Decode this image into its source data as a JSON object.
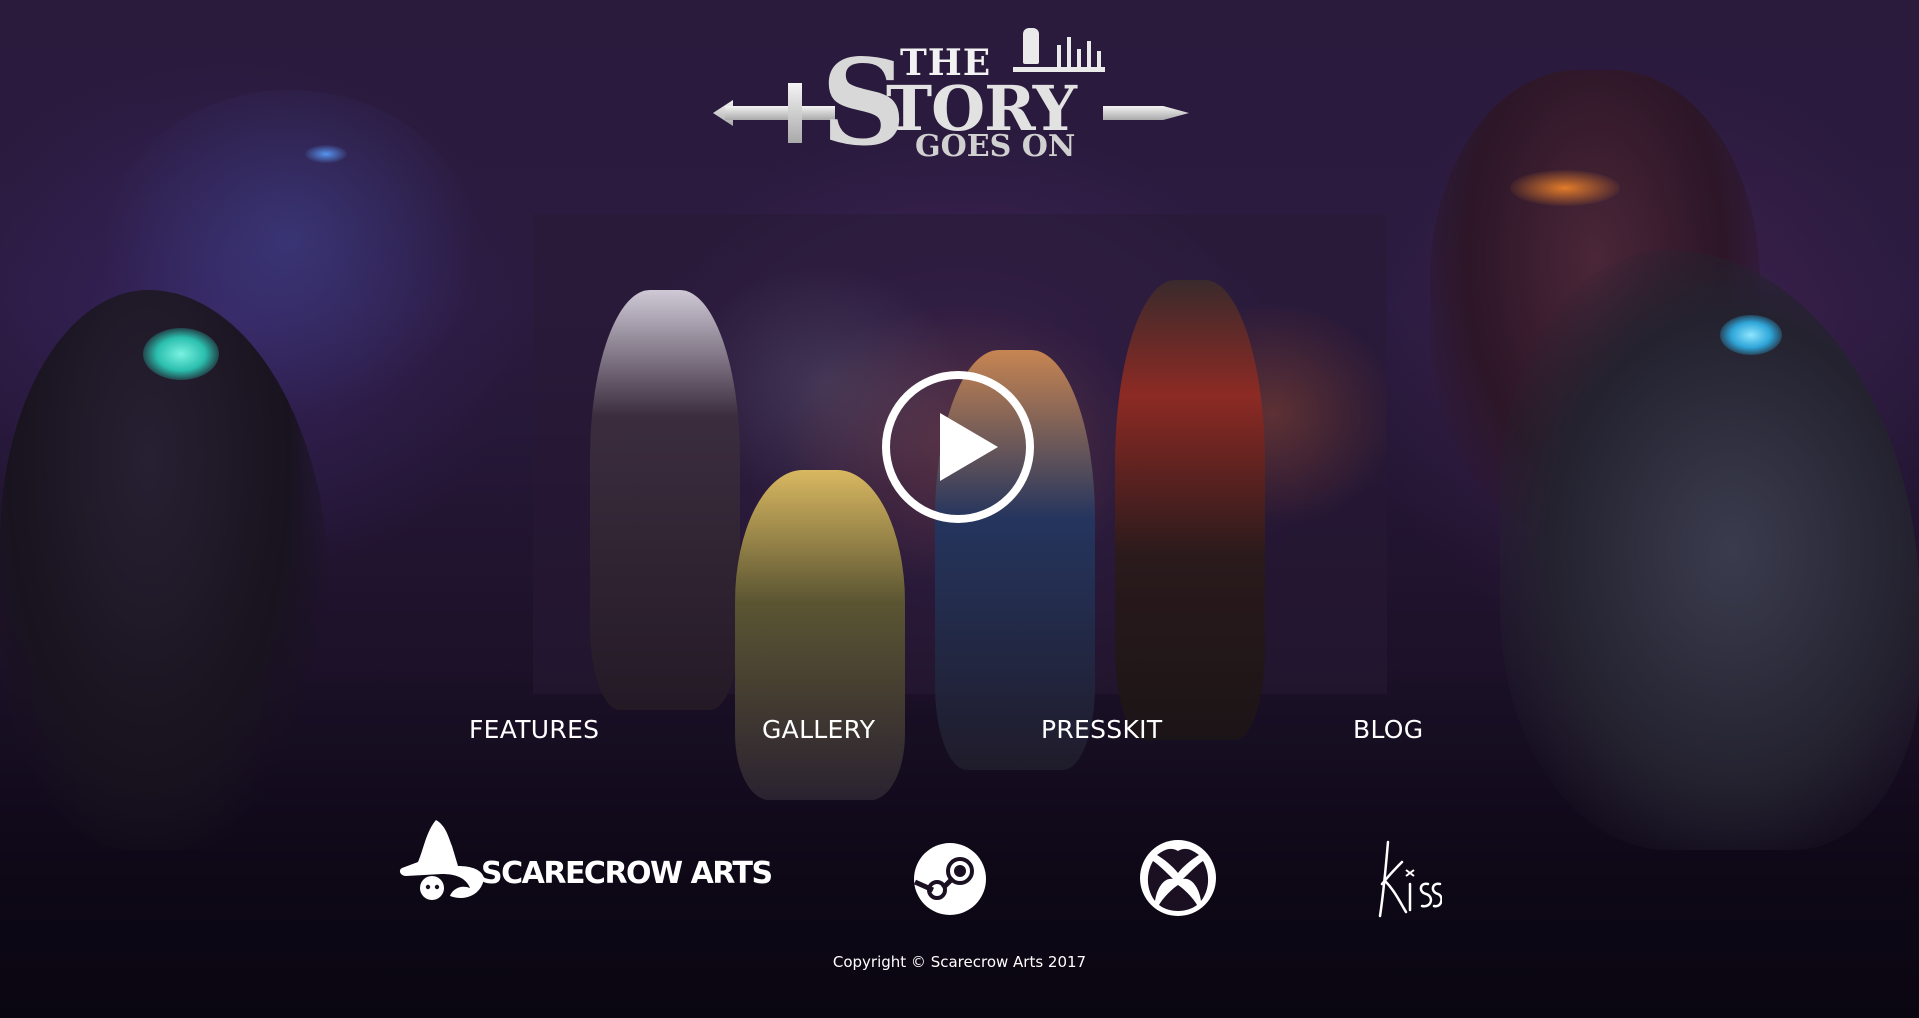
{
  "logo": {
    "the": "THE",
    "story_s": "S",
    "story_rest": "TORY",
    "goes_on": "GOES ON"
  },
  "video": {
    "play_icon": "play-icon"
  },
  "nav": {
    "items": [
      {
        "label": "FEATURES"
      },
      {
        "label": "GALLERY"
      },
      {
        "label": "PRESSKIT"
      },
      {
        "label": "BLOG"
      }
    ]
  },
  "footer": {
    "studio_name": "SCARECROW ARTS",
    "platforms": [
      {
        "icon": "steam-icon"
      },
      {
        "icon": "xbox-icon"
      },
      {
        "icon": "kiss-logo"
      }
    ],
    "kiss_label": "kiss",
    "copyright": "Copyright © Scarecrow Arts 2017"
  },
  "colors": {
    "background": "#2a1a3c",
    "text": "#ffffff"
  }
}
